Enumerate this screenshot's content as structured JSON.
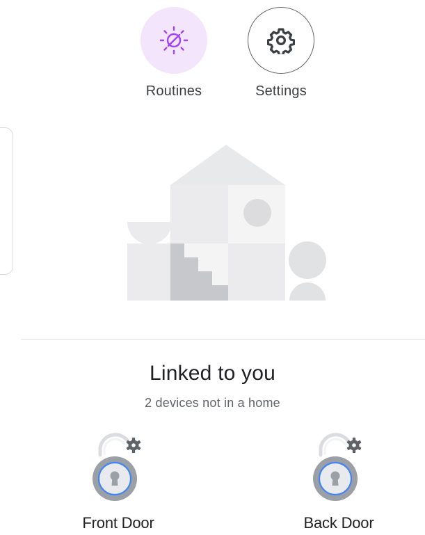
{
  "quick_actions": {
    "routines": {
      "label": "Routines",
      "icon": "routines-sun-icon",
      "accent": "#a142f4"
    },
    "settings": {
      "label": "Settings",
      "icon": "gear-icon"
    }
  },
  "linked": {
    "title": "Linked to you",
    "subtitle": "2 devices not in a home"
  },
  "devices": [
    {
      "name": "Front Door",
      "icon": "smart-lock-icon"
    },
    {
      "name": "Back Door",
      "icon": "smart-lock-icon"
    }
  ],
  "colors": {
    "lock_ring": "#4285f4",
    "lock_body": "#9aa0a6",
    "routines_bg": "#f3e6fc"
  }
}
